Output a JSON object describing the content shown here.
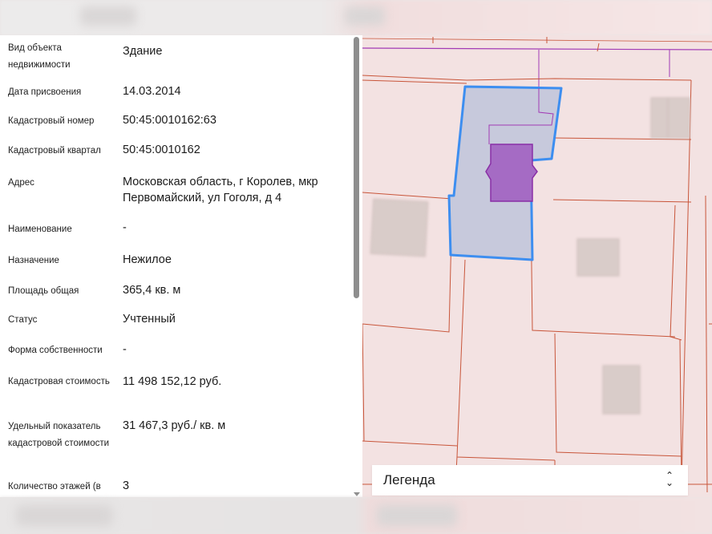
{
  "object_info": {
    "rows": [
      {
        "label": "Вид объекта недвижимости",
        "value": "Здание"
      },
      {
        "label": "Дата присвоения",
        "value": "14.03.2014"
      },
      {
        "label": "Кадастровый номер",
        "value": "50:45:0010162:63"
      },
      {
        "label": "Кадастровый квартал",
        "value": "50:45:0010162"
      },
      {
        "label": "Адрес",
        "value": "Московская область, г Королев, мкр Первомайский, ул Гоголя, д 4"
      },
      {
        "label": "Наименование",
        "value": "-"
      },
      {
        "label": "Назначение",
        "value": "Нежилое"
      },
      {
        "label": "Площадь общая",
        "value": "365,4 кв. м"
      },
      {
        "label": "Статус",
        "value": "Учтенный"
      },
      {
        "label": "Форма собственности",
        "value": "-"
      },
      {
        "label": "Кадастровая стоимость",
        "value": "11 498 152,12 руб."
      },
      {
        "label": "Удельный показатель кадастровой стоимости",
        "value": "31 467,3 руб./ кв. м"
      },
      {
        "label": "Количество этажей (в",
        "value": "3"
      }
    ]
  },
  "map": {
    "parcel_border_color": "#c8553a",
    "selected_parcel_fill": "#c7c9dc",
    "selected_parcel_stroke": "#3d8ef0",
    "building_fill": "#a56bc4",
    "building_stroke": "#8a2fa6",
    "background_color": "#f3e2e2"
  },
  "legend": {
    "label": "Легенда",
    "toggle_icon": "chevron-up-down-icon"
  }
}
